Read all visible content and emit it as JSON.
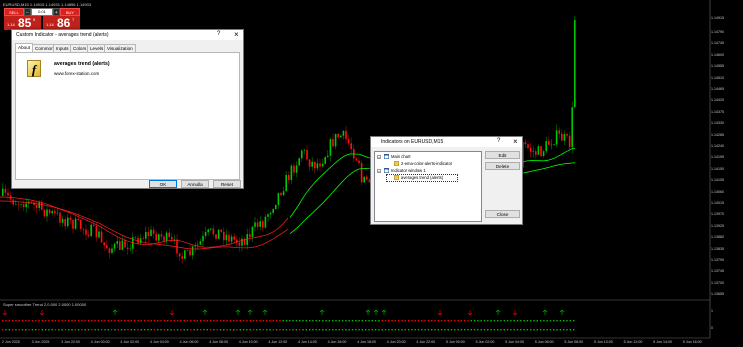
{
  "window": {
    "symbol_title": "EURUSD,M15  1.14915 1.14931 1.14896 1.14903"
  },
  "trade_panel": {
    "sell_label": "SELL",
    "buy_label": "BUY",
    "lot_value": "0.01",
    "minus_label": "−",
    "plus_label": "+",
    "bid": {
      "prefix": "1.14",
      "big": "85",
      "sup": "5"
    },
    "ask": {
      "prefix": "1.14",
      "big": "86",
      "sup": "7"
    }
  },
  "price_axis": [
    "1.14915",
    "1.14790",
    "1.14745",
    "1.14600",
    "1.14555",
    "1.14510",
    "1.14465",
    "1.14420",
    "1.14375",
    "1.14330",
    "1.14285",
    "1.14240",
    "1.14195",
    "1.14150",
    "1.14105",
    "1.14060",
    "1.14015",
    "1.13970",
    "1.13925",
    "1.13880",
    "1.13835",
    "1.13790",
    "1.13745",
    "1.13700",
    "1.13655"
  ],
  "time_axis": [
    "2 Jun 2025",
    "3 Jun 2025",
    "3 Jun 22:00",
    "4 Jun 00:00",
    "4 Jun 02:00",
    "4 Jun 04:00",
    "4 Jun 06:00",
    "4 Jun 08:00",
    "4 Jun 10:00",
    "4 Jun 12:00",
    "4 Jun 14:00",
    "4 Jun 16:00",
    "4 Jun 18:00",
    "4 Jun 20:00",
    "4 Jun 22:00",
    "5 Jun 00:00",
    "5 Jun 02:00",
    "5 Jun 04:00",
    "5 Jun 06:00",
    "5 Jun 08:00",
    "5 Jun 10:00",
    "5 Jun 12:00",
    "5 Jun 14:00",
    "5 Jun 16:00"
  ],
  "subwindow": {
    "title": "Super smoother Trend 2,0.000 2.0000 1.00000",
    "levels": [
      "1",
      "0"
    ]
  },
  "custom_indicator_dialog": {
    "title": "Custom Indicator - averages trend (alerts)",
    "help": "?",
    "close": "×",
    "tabs": [
      "About",
      "Common",
      "Inputs",
      "Colors",
      "Levels",
      "Visualization"
    ],
    "active_tab": "About",
    "icon_glyph": "f",
    "indicator_name": "averages trend (alerts)",
    "website": "www.forex-station.com",
    "ok_label": "OK",
    "cancel_label": "Annulla",
    "reset_label": "Reset"
  },
  "indicators_dialog": {
    "title": "Indicators on EURUSD,M15",
    "help": "?",
    "close": "×",
    "tree": [
      "Main chart",
      "2-ema-color-alerts-indicator",
      "Indicator window 1",
      "averages trend (alerts)"
    ],
    "edit_label": "Edit",
    "delete_label": "Delete",
    "close_label": "Close"
  },
  "colors": {
    "bull_candle": "#00c800",
    "bear_candle": "#ff1010",
    "ema_fast_green": "#00ff00",
    "ema_slow_red": "#ff2020",
    "up_arrow": "#00c000",
    "down_arrow": "#ff0000",
    "dialog_bg": "#f0f0f0"
  }
}
